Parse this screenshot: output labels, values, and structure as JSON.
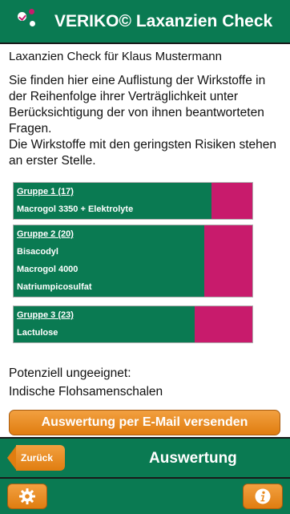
{
  "header": {
    "title": "VERIKO© Laxanzien Check",
    "logo_icon": "veriko-logo-icon"
  },
  "main": {
    "subtitle": "Laxanzien Check für Klaus Mustermann",
    "intro_line1": "Sie finden hier eine Auflistung der Wirkstoffe in der Reihenfolge ihrer Verträglichkeit unter Berücksichtigung der von ihnen beantworteten Fragen.",
    "intro_line2": "Die Wirkstoffe mit den geringsten Risiken stehen an erster Stelle."
  },
  "groups": [
    {
      "label": "Gruppe 1 (17)",
      "score": 17,
      "fill_fraction": 0.83,
      "items": [
        "Macrogol 3350 + Elektrolyte"
      ]
    },
    {
      "label": "Gruppe 2 (20)",
      "score": 20,
      "fill_fraction": 0.8,
      "items": [
        "Bisacodyl",
        "Macrogol 4000",
        "Natriumpicosulfat"
      ]
    },
    {
      "label": "Gruppe 3 (23)",
      "score": 23,
      "fill_fraction": 0.76,
      "items": [
        "Lactulose"
      ]
    }
  ],
  "unsuitable": {
    "label": "Potenziell ungeeignet:",
    "item": "Indische Flohsamenschalen"
  },
  "email_button": "Auswertung per E-Mail versenden",
  "navbar": {
    "back_label": "Zurück",
    "title": "Auswertung"
  },
  "footer": {
    "settings_icon": "gear-icon",
    "info_icon": "info-icon"
  },
  "colors": {
    "primary_green": "#0a7a52",
    "accent_magenta": "#c81b6c",
    "button_orange": "#e07d10"
  }
}
